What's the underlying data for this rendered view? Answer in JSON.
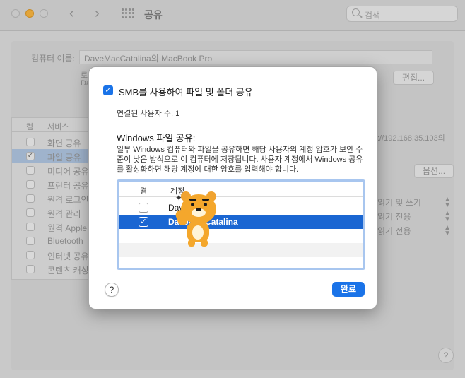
{
  "window": {
    "title": "공유",
    "back_glyph": "‹",
    "forward_glyph": "›",
    "search_placeholder": "검색"
  },
  "background": {
    "computer_name_label": "컴퓨터 이름:",
    "computer_name_value": "DaveMacCatalina의 MacBook Pro",
    "edit_button": "편집...",
    "fragments": [
      "로",
      "Da"
    ],
    "services_header_on": "켬",
    "services_header_name": "서비스",
    "services": [
      {
        "label": "화면 공유",
        "checked": false,
        "selected": false
      },
      {
        "label": "파일 공유",
        "checked": true,
        "selected": true
      },
      {
        "label": "미디어 공유",
        "checked": false,
        "selected": false
      },
      {
        "label": "프린터 공유",
        "checked": false,
        "selected": false
      },
      {
        "label": "원격 로그인",
        "checked": false,
        "selected": false
      },
      {
        "label": "원격 관리",
        "checked": false,
        "selected": false
      },
      {
        "label": "원격 Apple",
        "checked": false,
        "selected": false
      },
      {
        "label": "Bluetooth",
        "checked": false,
        "selected": false
      },
      {
        "label": "인터넷 공유",
        "checked": false,
        "selected": false
      },
      {
        "label": "콘텐츠 캐싱",
        "checked": false,
        "selected": false
      }
    ],
    "ip_fragment": "://192.168.35.103의",
    "options_button": "옵션...",
    "permissions": [
      "읽기 및 쓰기",
      "읽기 전용",
      "읽기 전용"
    ],
    "help": "?"
  },
  "sheet": {
    "smb_checked": true,
    "smb_label": "SMB를 사용하여 파일 및 폴더 공유",
    "connected_users": "연결된 사용자 수: 1",
    "windows_share_title": "Windows 파일 공유:",
    "description": "일부 Windows 컴퓨터와 파일을 공유하면 해당 사용자의 계정 암호가 보안 수준이 낮은 방식으로 이 컴퓨터에 저장됩니다. 사용자 계정에서 Windows 공유를 활성화하면 해당 계정에 대한 암호를 입력해야 합니다.",
    "table_header_on": "켬",
    "table_header_account": "계정",
    "accounts": [
      {
        "name": "Dav",
        "checked": false,
        "selected": false
      },
      {
        "name": "DaveMacCatalina",
        "checked": true,
        "selected": true
      }
    ],
    "help": "?",
    "done_button": "완료",
    "sticker_icon": "ryan-sticker-icon"
  },
  "colors": {
    "accent": "#1a73e8",
    "selection": "#1a66d2",
    "sticker": "#f4a72c"
  }
}
